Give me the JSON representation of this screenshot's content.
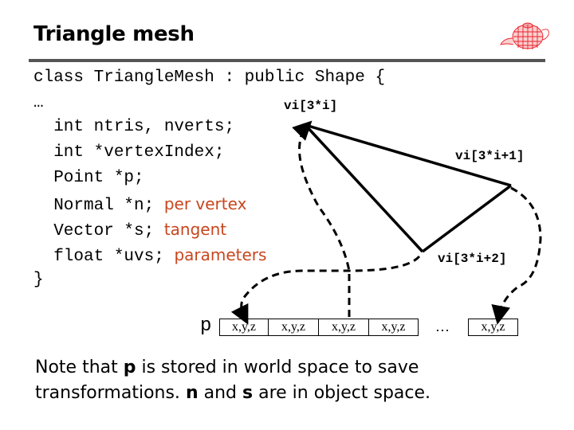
{
  "slide": {
    "title": "Triangle mesh",
    "logo_icon": "teapot-wireframe-icon",
    "accent_color": "#c8461e",
    "rule_color": "#555555"
  },
  "code": {
    "lines": [
      {
        "text": "class TriangleMesh : public Shape {",
        "comment": ""
      },
      {
        "text": "…",
        "comment": ""
      },
      {
        "text": "  int ntris, nverts;",
        "comment": ""
      },
      {
        "text": "  int *vertexIndex;",
        "comment": ""
      },
      {
        "text": "  Point *p;",
        "comment": ""
      },
      {
        "text": "  Normal *n; ",
        "comment": "per vertex"
      },
      {
        "text": "  Vector *s; ",
        "comment": "tangent"
      },
      {
        "text": "  float *uvs; ",
        "comment": "parameters"
      },
      {
        "text": "}",
        "comment": ""
      }
    ]
  },
  "diagram": {
    "vertex_labels": [
      "vi[3*i]",
      "vi[3*i+1]",
      "vi[3*i+2]"
    ],
    "array_name": "p",
    "cells": [
      "x,y,z",
      "x,y,z",
      "x,y,z",
      "x,y,z"
    ],
    "ellipsis": "…",
    "last_cell": "x,y,z"
  },
  "note": {
    "line1_a": "Note that ",
    "line1_b": "p",
    "line1_c": " is stored in world space to save",
    "line2_a": "transformations. ",
    "line2_b": "n",
    "line2_c": " and ",
    "line2_d": "s",
    "line2_e": " are in object space."
  }
}
